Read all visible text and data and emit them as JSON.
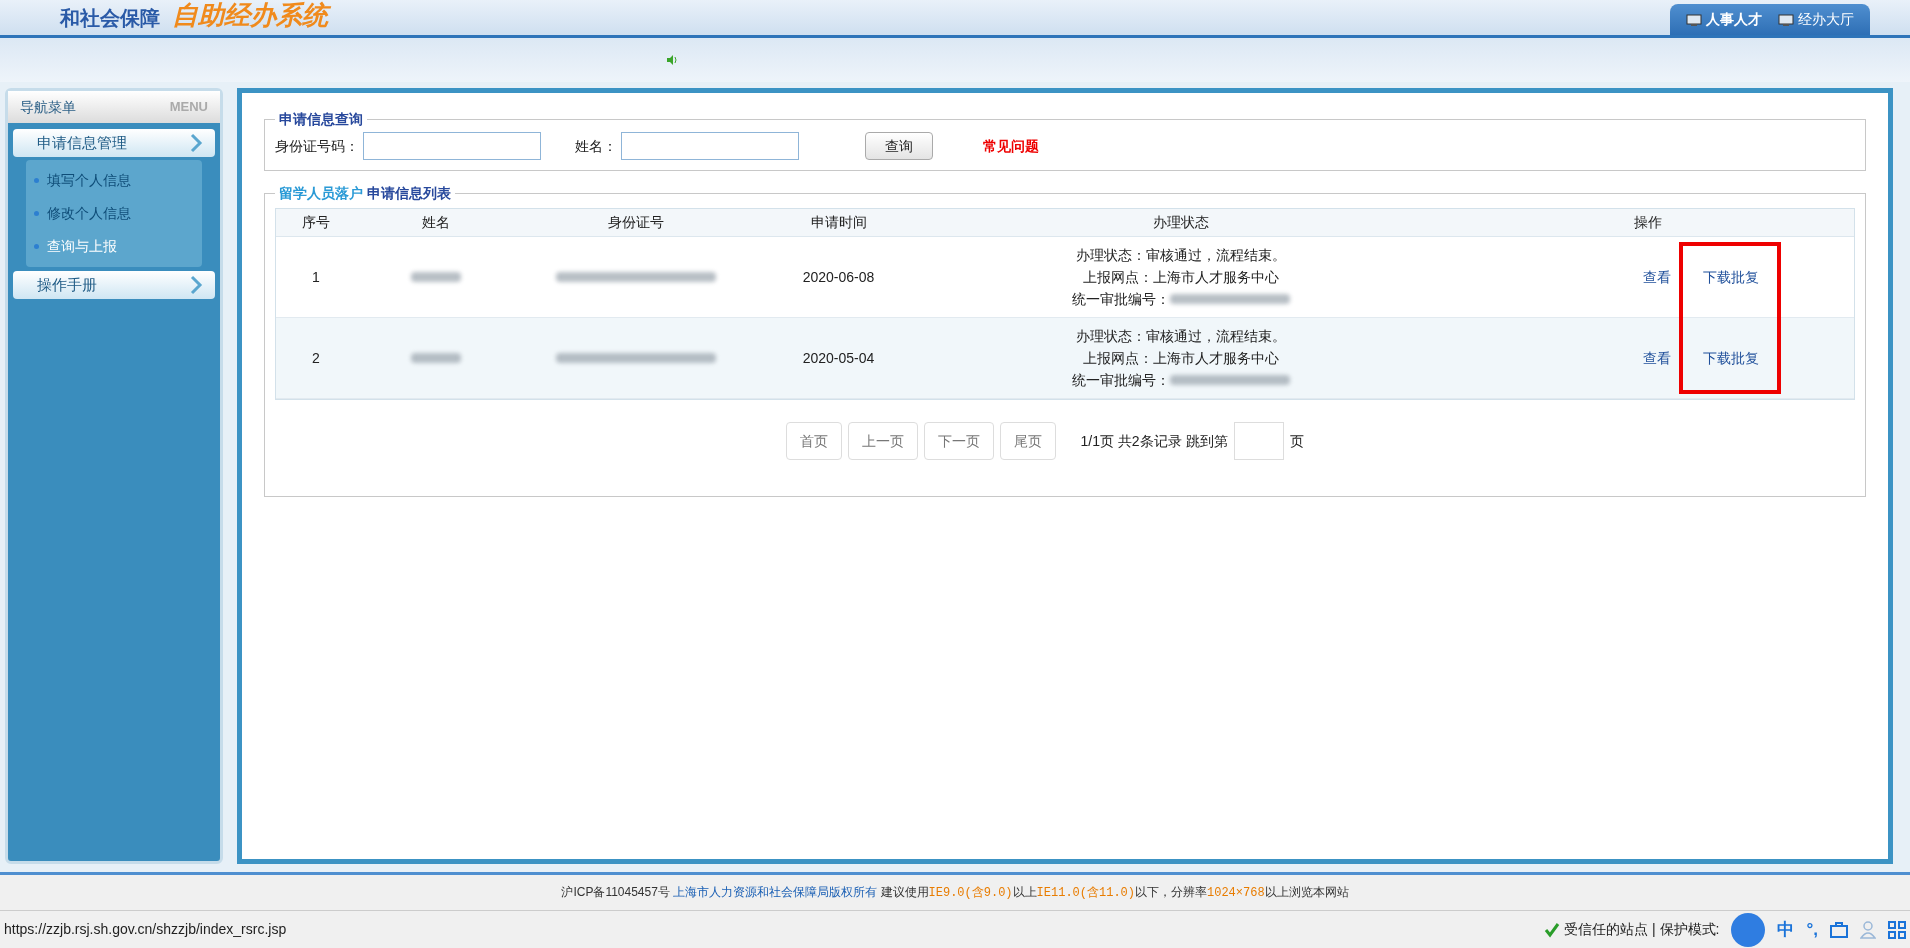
{
  "header": {
    "logo_left": "和社会保障",
    "logo_right": "自助经办系统",
    "tabs": [
      {
        "label": "人事人才",
        "selected": true
      },
      {
        "label": "经办大厅",
        "selected": false
      }
    ]
  },
  "sidebar": {
    "title": "导航菜单",
    "title_en": "MENU",
    "groups": [
      {
        "label": "申请信息管理",
        "children": [
          {
            "label": "填写个人信息",
            "selected": false
          },
          {
            "label": "修改个人信息",
            "selected": false
          },
          {
            "label": "查询与上报",
            "selected": true
          }
        ]
      },
      {
        "label": "操作手册"
      }
    ]
  },
  "search": {
    "legend": "申请信息查询",
    "fields": [
      {
        "label": "身份证号码："
      },
      {
        "label": "姓名："
      }
    ],
    "button": "查询",
    "faq_link": "常见问题"
  },
  "list": {
    "legend_prefix": "留学人员落户",
    "legend": "申请信息列表",
    "highlight_actions": true,
    "columns": [
      "序号",
      "姓名",
      "身份证号",
      "申请时间",
      "办理状态",
      "操作"
    ],
    "rows": [
      {
        "index": "1",
        "date": "2020-06-08",
        "status": "办理状态：审核通过，流程结束。",
        "site": "上报网点：上海市人才服务中心",
        "approval_label": "统一审批编号：",
        "actions": [
          "查看",
          "下载批复"
        ]
      },
      {
        "index": "2",
        "date": "2020-05-04",
        "status": "办理状态：审核通过，流程结束。",
        "site": "上报网点：上海市人才服务中心",
        "approval_label": "统一审批编号：",
        "actions": [
          "查看",
          "下载批复"
        ]
      }
    ],
    "pager": {
      "buttons": [
        "首页",
        "上一页",
        "下一页",
        "尾页"
      ],
      "info": "1/1页 共2条记录 跳到第",
      "suffix": "页"
    }
  },
  "footer": {
    "parts": [
      {
        "text": "沪ICP备11045457号 ",
        "kind": "plain"
      },
      {
        "text": "上海市人力资源和社会保障局版权所有",
        "kind": "link"
      },
      {
        "text": " 建议使用",
        "kind": "plain"
      },
      {
        "text": "IE9.0(含9.0)",
        "kind": "highlight"
      },
      {
        "text": "以上",
        "kind": "plain"
      },
      {
        "text": "IE11.0(含11.0)",
        "kind": "highlight"
      },
      {
        "text": "以下，分辨率",
        "kind": "plain"
      },
      {
        "text": "1024×768",
        "kind": "highlight"
      },
      {
        "text": "以上浏览本网站",
        "kind": "plain"
      }
    ]
  },
  "status_bar": {
    "url": "https://zzjb.rsj.sh.gov.cn/shzzjb/index_rsrc.jsp",
    "zone": "受信任的站点 | 保护模式: ",
    "ime": "中",
    "ime_punct": "°,"
  }
}
